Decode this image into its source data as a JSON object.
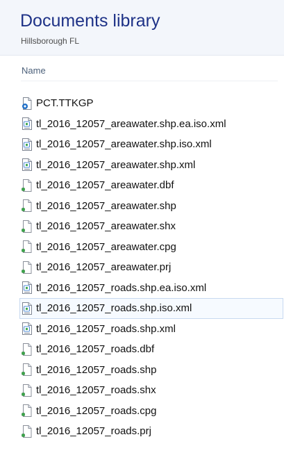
{
  "library": {
    "title": "Documents library",
    "subtitle": "Hillsborough FL"
  },
  "columns": {
    "name_label": "Name"
  },
  "files": [
    {
      "name": "PCT.TTKGP",
      "icon": "config-file-icon",
      "selected": false
    },
    {
      "name": "tl_2016_12057_areawater.shp.ea.iso.xml",
      "icon": "xml-file-icon",
      "selected": false
    },
    {
      "name": "tl_2016_12057_areawater.shp.iso.xml",
      "icon": "xml-file-icon",
      "selected": false
    },
    {
      "name": "tl_2016_12057_areawater.shp.xml",
      "icon": "xml-file-icon",
      "selected": false
    },
    {
      "name": "tl_2016_12057_areawater.dbf",
      "icon": "generic-file-icon",
      "selected": false
    },
    {
      "name": "tl_2016_12057_areawater.shp",
      "icon": "generic-file-icon",
      "selected": false
    },
    {
      "name": "tl_2016_12057_areawater.shx",
      "icon": "generic-file-icon",
      "selected": false
    },
    {
      "name": "tl_2016_12057_areawater.cpg",
      "icon": "generic-file-icon",
      "selected": false
    },
    {
      "name": "tl_2016_12057_areawater.prj",
      "icon": "generic-file-icon",
      "selected": false
    },
    {
      "name": "tl_2016_12057_roads.shp.ea.iso.xml",
      "icon": "xml-file-icon",
      "selected": false
    },
    {
      "name": "tl_2016_12057_roads.shp.iso.xml",
      "icon": "xml-file-icon",
      "selected": true
    },
    {
      "name": "tl_2016_12057_roads.shp.xml",
      "icon": "xml-file-icon",
      "selected": false
    },
    {
      "name": "tl_2016_12057_roads.dbf",
      "icon": "generic-file-icon",
      "selected": false
    },
    {
      "name": "tl_2016_12057_roads.shp",
      "icon": "generic-file-icon",
      "selected": false
    },
    {
      "name": "tl_2016_12057_roads.shx",
      "icon": "generic-file-icon",
      "selected": false
    },
    {
      "name": "tl_2016_12057_roads.cpg",
      "icon": "generic-file-icon",
      "selected": false
    },
    {
      "name": "tl_2016_12057_roads.prj",
      "icon": "generic-file-icon",
      "selected": false
    }
  ],
  "colors": {
    "title": "#1e3287",
    "header_bg": "#f3f6fb",
    "selection_border": "#c7d9f0",
    "selection_bg": "#f6faff"
  }
}
